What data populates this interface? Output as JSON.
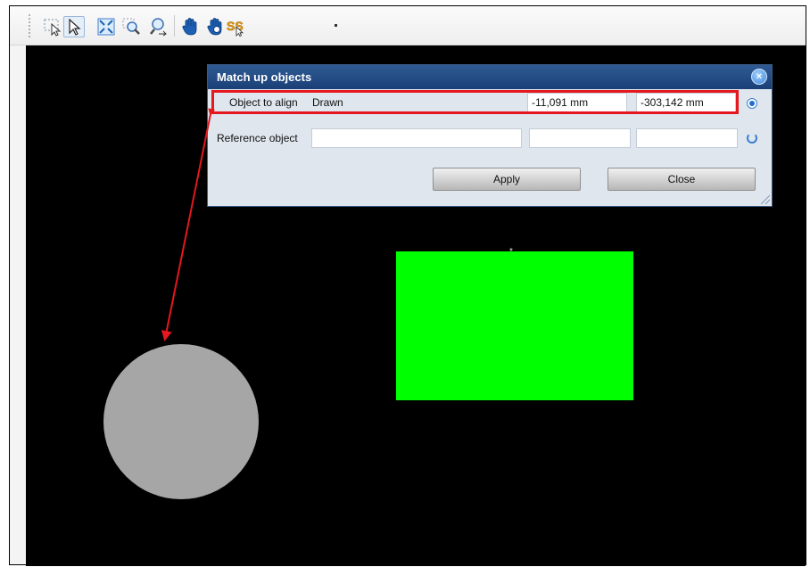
{
  "toolbar": {
    "buttons": [
      {
        "icon": "lasso-select-icon"
      },
      {
        "icon": "pointer-select-icon",
        "active": true
      },
      {
        "icon": "zoom-extents-icon"
      },
      {
        "icon": "zoom-window-icon"
      },
      {
        "icon": "zoom-in-out-icon"
      },
      {
        "icon": "pan-hand-icon"
      },
      {
        "icon": "pan-hand-alt-icon"
      },
      {
        "icon": "snap-icon"
      }
    ]
  },
  "dialog": {
    "title": "Match up objects",
    "close_glyph": "×",
    "rows": [
      {
        "label": "Object to align",
        "name": "Drawn",
        "x": "-11,091 mm",
        "y": "-303,142 mm",
        "selected": true
      },
      {
        "label": "Reference object",
        "name": "",
        "x": "",
        "y": "",
        "selected": false
      }
    ],
    "apply_label": "Apply",
    "close_label": "Close"
  },
  "annotation": {
    "callout": "1",
    "highlight_color": "#e5171f"
  },
  "canvas": {
    "background": "#000000",
    "circle_color": "#a6a6a6",
    "rectangle_color": "#00ff00",
    "center_marker": "*"
  }
}
